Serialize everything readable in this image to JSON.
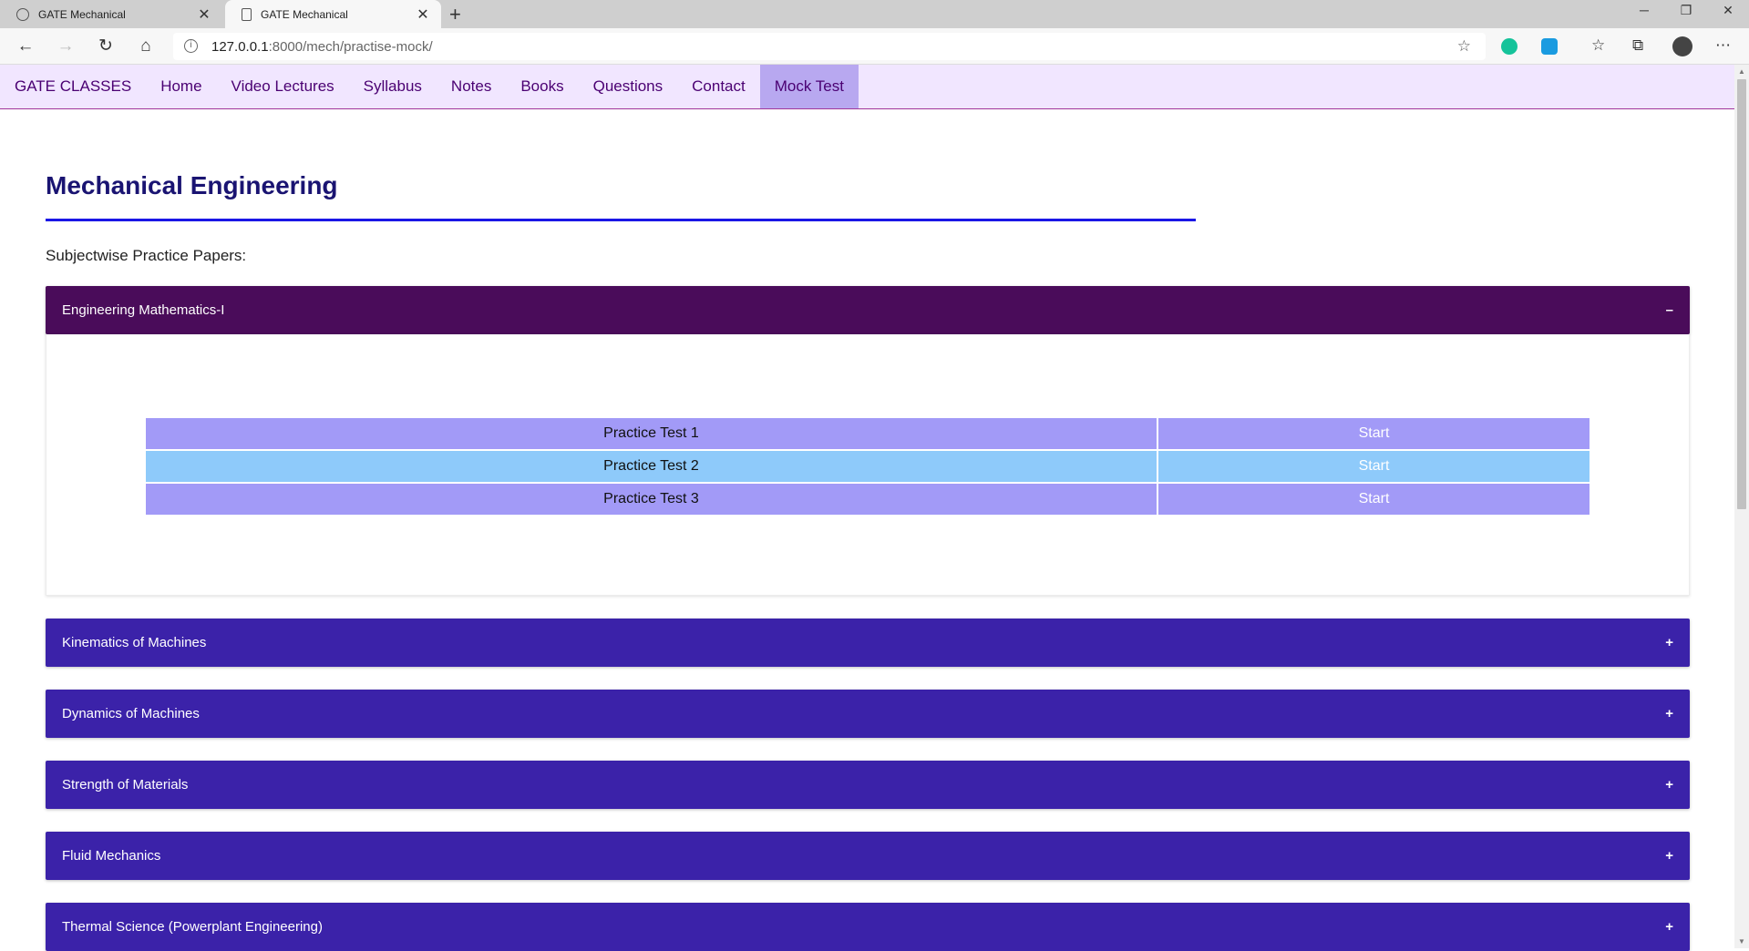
{
  "browser": {
    "tabs": [
      {
        "title": "GATE Mechanical",
        "close": "✕"
      },
      {
        "title": "GATE Mechanical",
        "close": "✕"
      }
    ],
    "new_tab": "+",
    "url_host": "127.0.0.1",
    "url_rest": ":8000/mech/practise-mock/"
  },
  "nav": {
    "brand": "GATE CLASSES",
    "items": [
      "Home",
      "Video Lectures",
      "Syllabus",
      "Notes",
      "Books",
      "Questions",
      "Contact",
      "Mock Test"
    ],
    "active": "Mock Test"
  },
  "page": {
    "title": "Mechanical Engineering",
    "subtitle": "Subjectwise Practice Papers:"
  },
  "accordion": [
    {
      "title": "Engineering Mathematics-I",
      "symbol": "–",
      "tests": [
        {
          "name": "Practice Test 1",
          "action": "Start"
        },
        {
          "name": "Practice Test 2",
          "action": "Start"
        },
        {
          "name": "Practice Test 3",
          "action": "Start"
        }
      ]
    },
    {
      "title": "Kinematics of Machines",
      "symbol": "+"
    },
    {
      "title": "Dynamics of Machines",
      "symbol": "+"
    },
    {
      "title": "Strength of Materials",
      "symbol": "+"
    },
    {
      "title": "Fluid Mechanics",
      "symbol": "+"
    },
    {
      "title": "Thermal Science (Powerplant Engineering)",
      "symbol": "+"
    }
  ],
  "colors": {
    "nav_bg": "#f1e6ff",
    "active_nav": "#b8a8f0",
    "open_header": "#4a0c5a",
    "closed_header": "#3b22a9",
    "row_a": "#a29af7",
    "row_b": "#8ecafa"
  }
}
